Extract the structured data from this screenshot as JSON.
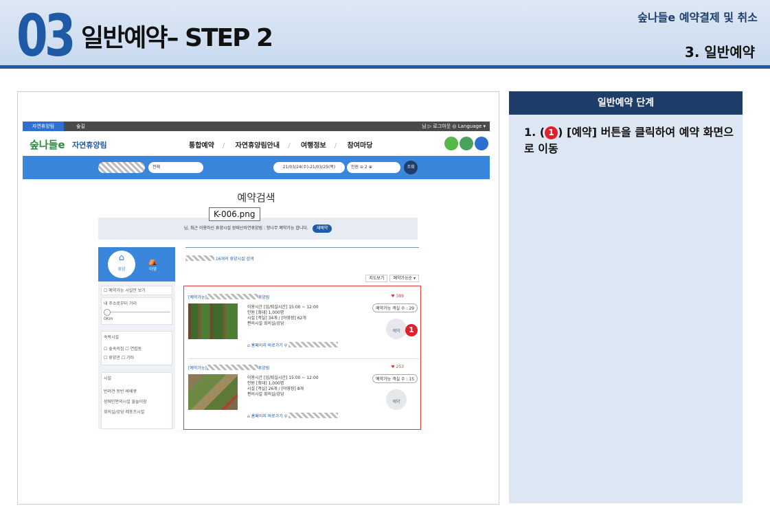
{
  "header": {
    "section_number": "03",
    "title": "일반예약– STEP 2",
    "right_top": "숲나들e 예약결제 및 취소",
    "right_bottom": "3. 일반예약"
  },
  "screenshot": {
    "top_bar": {
      "left_tab": "자연휴양림",
      "second": "숲길",
      "right": "님  ▷ 로그아웃  ◎ Language ▾"
    },
    "logo": "숲나들e",
    "site_name": "자연휴양림",
    "menu": [
      "통합예약",
      "자연휴양림안내",
      "여행정보",
      "참여마당"
    ],
    "search_bar": {
      "region": "전체",
      "date": "21/03/24(수)-21/03/25(목)",
      "people_label": "인원",
      "people_count": "2",
      "search_button": "조회"
    },
    "page_heading": "예약검색",
    "notice_text": "님, 최근 이용하신 휴양시설 장태산자연휴양림 : 향나무 예약가능 합니다.",
    "notice_button": "재예약",
    "left_panel": {
      "tab1": "휴양",
      "tab2": "야영",
      "checkbox_label": "예약가능 시설만 보기",
      "distance_label": "내 주소로부터 거리",
      "distance_value": "0Km",
      "lodging_title": "숙박시설",
      "lodging_items": [
        "숲속의집",
        "연립동",
        "휴양관",
        "기타"
      ],
      "facility_title": "시설",
      "facility_items": [
        "반려견 동반",
        "바베큐",
        "장애인편의시설",
        "물놀이장",
        "회의실/강당",
        "레포츠시설"
      ]
    },
    "results": {
      "count_text": "16개의 휴양시설 검색",
      "map_button": "지도보기",
      "sort_button": "예약가능순 ▾",
      "items": [
        {
          "status": "[예약가능]",
          "suffix": "휴양림",
          "likes": "389",
          "available": "예약가능 객실 수 : 29",
          "lines": [
            "이용시간   [입/퇴실시간] 15:00 ~ 12:00",
            "인원          [최대] 1,000명",
            "시설          [객실] 34개 / [야영장] 62개",
            "편의시설   회의실/강당"
          ],
          "reserve": "예약",
          "homepage": "홈페이지 바로가기"
        },
        {
          "status": "[예약가능]",
          "suffix": "휴양림",
          "likes": "253",
          "available": "예약가능 객실 수 : 15",
          "lines": [
            "이용시간   [입/퇴실시간] 15:00 ~ 12:00",
            "인원          [최대] 1,000명",
            "시설          [객실] 26개 / [야영장] 8개",
            "편의시설   회의실/강당"
          ],
          "reserve": "예약",
          "homepage": "홈페이지 바로가기"
        }
      ]
    },
    "badge_number": "1",
    "tooltip": "K-006.png"
  },
  "panel": {
    "heading": "일반예약 단계",
    "step_prefix": "1. (",
    "step_badge": "1",
    "step_text": ") [예약] 버튼을 클릭하여 예약 화면으로 이동"
  },
  "colors": {
    "brand_blue": "#1f5aa6",
    "navy": "#1f3d6b",
    "accent_red": "#e0202a",
    "panel_bg": "#dde6f3"
  }
}
